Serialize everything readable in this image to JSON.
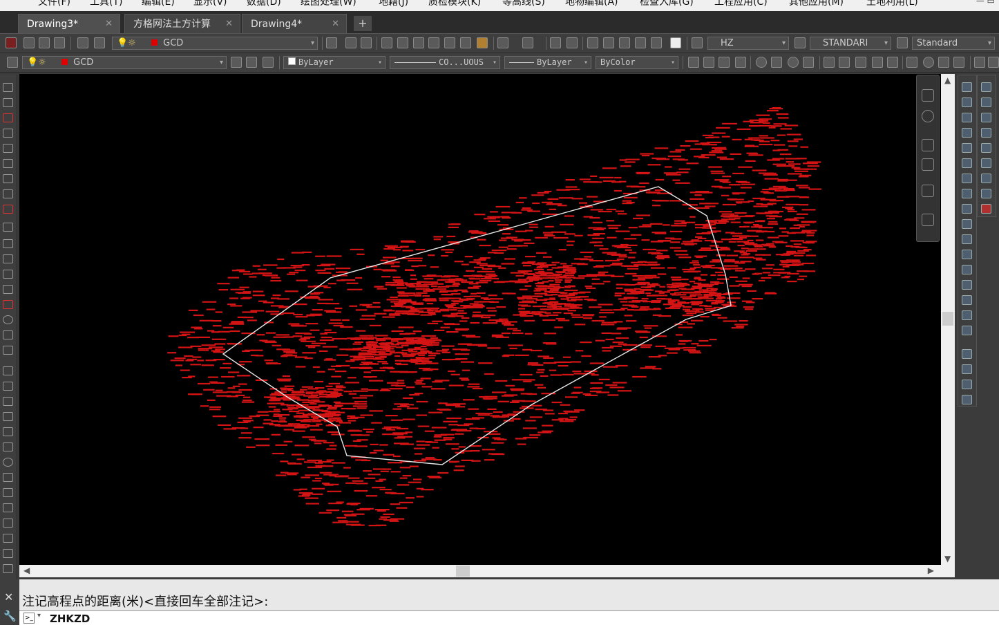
{
  "menu": [
    "文件(F)",
    "工具(T)",
    "编辑(E)",
    "显示(V)",
    "数据(D)",
    "绘图处理(W)",
    "地籍(J)",
    "质检模块(K)",
    "等高线(S)",
    "地物编辑(A)",
    "检查入库(G)",
    "工程应用(C)",
    "其他应用(M)",
    "土地利用(L)"
  ],
  "tabs": [
    {
      "label": "Drawing3*"
    },
    {
      "label": "方格网法土方计算"
    },
    {
      "label": "Drawing4*"
    }
  ],
  "toolbar1": {
    "layer": "GCD",
    "text_style": "HZ",
    "dim_style": "STANDARI",
    "table_style": "Standard"
  },
  "toolbar2": {
    "layer": "GCD",
    "color": "ByLayer",
    "linetype": "CO...UOUS",
    "lineweight": "ByLayer",
    "plot_style": "ByColor"
  },
  "command": {
    "history": "注记高程点的距离(米)<直接回车全部注记>:",
    "input": "ZHKZD"
  },
  "colors": {
    "canvas_bg": "#000000",
    "point_color": "#d41414",
    "boundary_color": "#e8e8e8",
    "layer_swatch": "#e00000"
  },
  "icons": [
    "close-icon",
    "wrench-icon",
    "command-prompt-icon",
    "plus-icon",
    "lightbulb-icon",
    "sun-icon",
    "lock-icon",
    "pan-icon",
    "zoom-icon",
    "undo-icon",
    "redo-icon",
    "help-icon"
  ]
}
